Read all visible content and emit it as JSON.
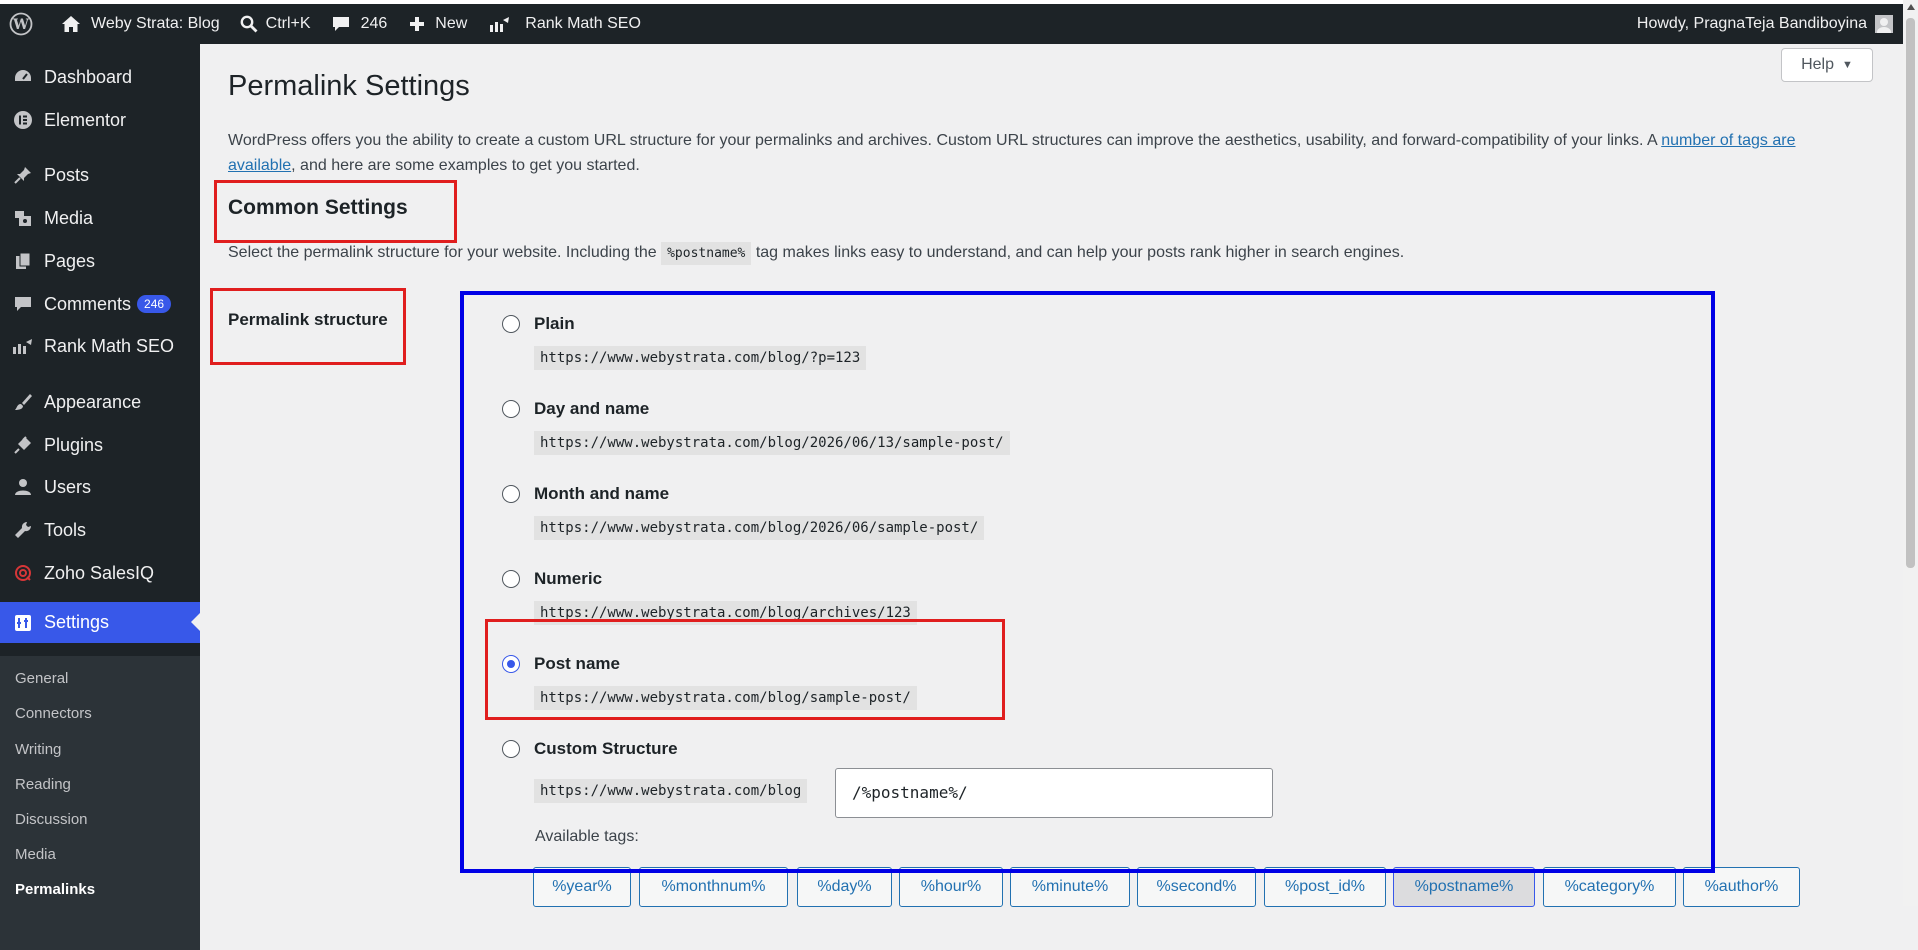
{
  "adminbar": {
    "site_name": "Weby Strata: Blog",
    "search_shortcut": "Ctrl+K",
    "comments_count": "246",
    "new_label": "New",
    "seo_label": "Rank Math SEO",
    "howdy": "Howdy, PragnaTeja Bandiboyina"
  },
  "sidebar": {
    "items": [
      {
        "label": "Dashboard",
        "icon": "dashboard-icon"
      },
      {
        "label": "Elementor",
        "icon": "elementor-icon"
      },
      {
        "label": "Posts",
        "icon": "pin-icon"
      },
      {
        "label": "Media",
        "icon": "media-icon"
      },
      {
        "label": "Pages",
        "icon": "pages-icon"
      },
      {
        "label": "Comments",
        "icon": "comment-icon",
        "badge": "246"
      },
      {
        "label": "Rank Math SEO",
        "icon": "rankmath-icon"
      },
      {
        "label": "Appearance",
        "icon": "brush-icon"
      },
      {
        "label": "Plugins",
        "icon": "plugin-icon"
      },
      {
        "label": "Users",
        "icon": "user-icon"
      },
      {
        "label": "Tools",
        "icon": "wrench-icon"
      },
      {
        "label": "Zoho SalesIQ",
        "icon": "zoho-icon"
      },
      {
        "label": "Settings",
        "icon": "settings-icon"
      }
    ],
    "submenu": [
      "General",
      "Connectors",
      "Writing",
      "Reading",
      "Discussion",
      "Media",
      "Permalinks"
    ]
  },
  "main": {
    "help": "Help",
    "title": "Permalink Settings",
    "intro_text": "WordPress offers you the ability to create a custom URL structure for your permalinks and archives. Custom URL structures can improve the aesthetics, usability, and forward-compatibility of your links. A ",
    "intro_link_1": "number of tags are",
    "intro_link_2": "available",
    "intro_tail": ", and here are some examples to get you started.",
    "section_heading": "Common Settings",
    "section_desc_before": "Select the permalink structure for your website. Including the ",
    "section_desc_code": "%postname%",
    "section_desc_after": " tag makes links easy to understand, and can help your posts rank higher in search engines.",
    "structure_label": "Permalink structure",
    "options": [
      {
        "label": "Plain",
        "example": "https://www.webystrata.com/blog/?p=123",
        "checked": false
      },
      {
        "label": "Day and name",
        "example": "https://www.webystrata.com/blog/2026/06/13/sample-post/",
        "checked": false
      },
      {
        "label": "Month and name",
        "example": "https://www.webystrata.com/blog/2026/06/sample-post/",
        "checked": false
      },
      {
        "label": "Numeric",
        "example": "https://www.webystrata.com/blog/archives/123",
        "checked": false
      },
      {
        "label": "Post name",
        "example": "https://www.webystrata.com/blog/sample-post/",
        "checked": true
      },
      {
        "label": "Custom Structure",
        "example": "https://www.webystrata.com/blog",
        "checked": false
      }
    ],
    "custom_value": "/%postname%/",
    "available_tags_label": "Available tags:",
    "tags": [
      "%year%",
      "%monthnum%",
      "%day%",
      "%hour%",
      "%minute%",
      "%second%",
      "%post_id%",
      "%postname%",
      "%category%",
      "%author%"
    ],
    "active_tag": "%postname%"
  },
  "colors": {
    "admin_dark": "#1d2327",
    "accent": "#3858e9",
    "link": "#2271b1",
    "annotation_red": "#e01e1e",
    "annotation_blue": "#0000e6"
  }
}
